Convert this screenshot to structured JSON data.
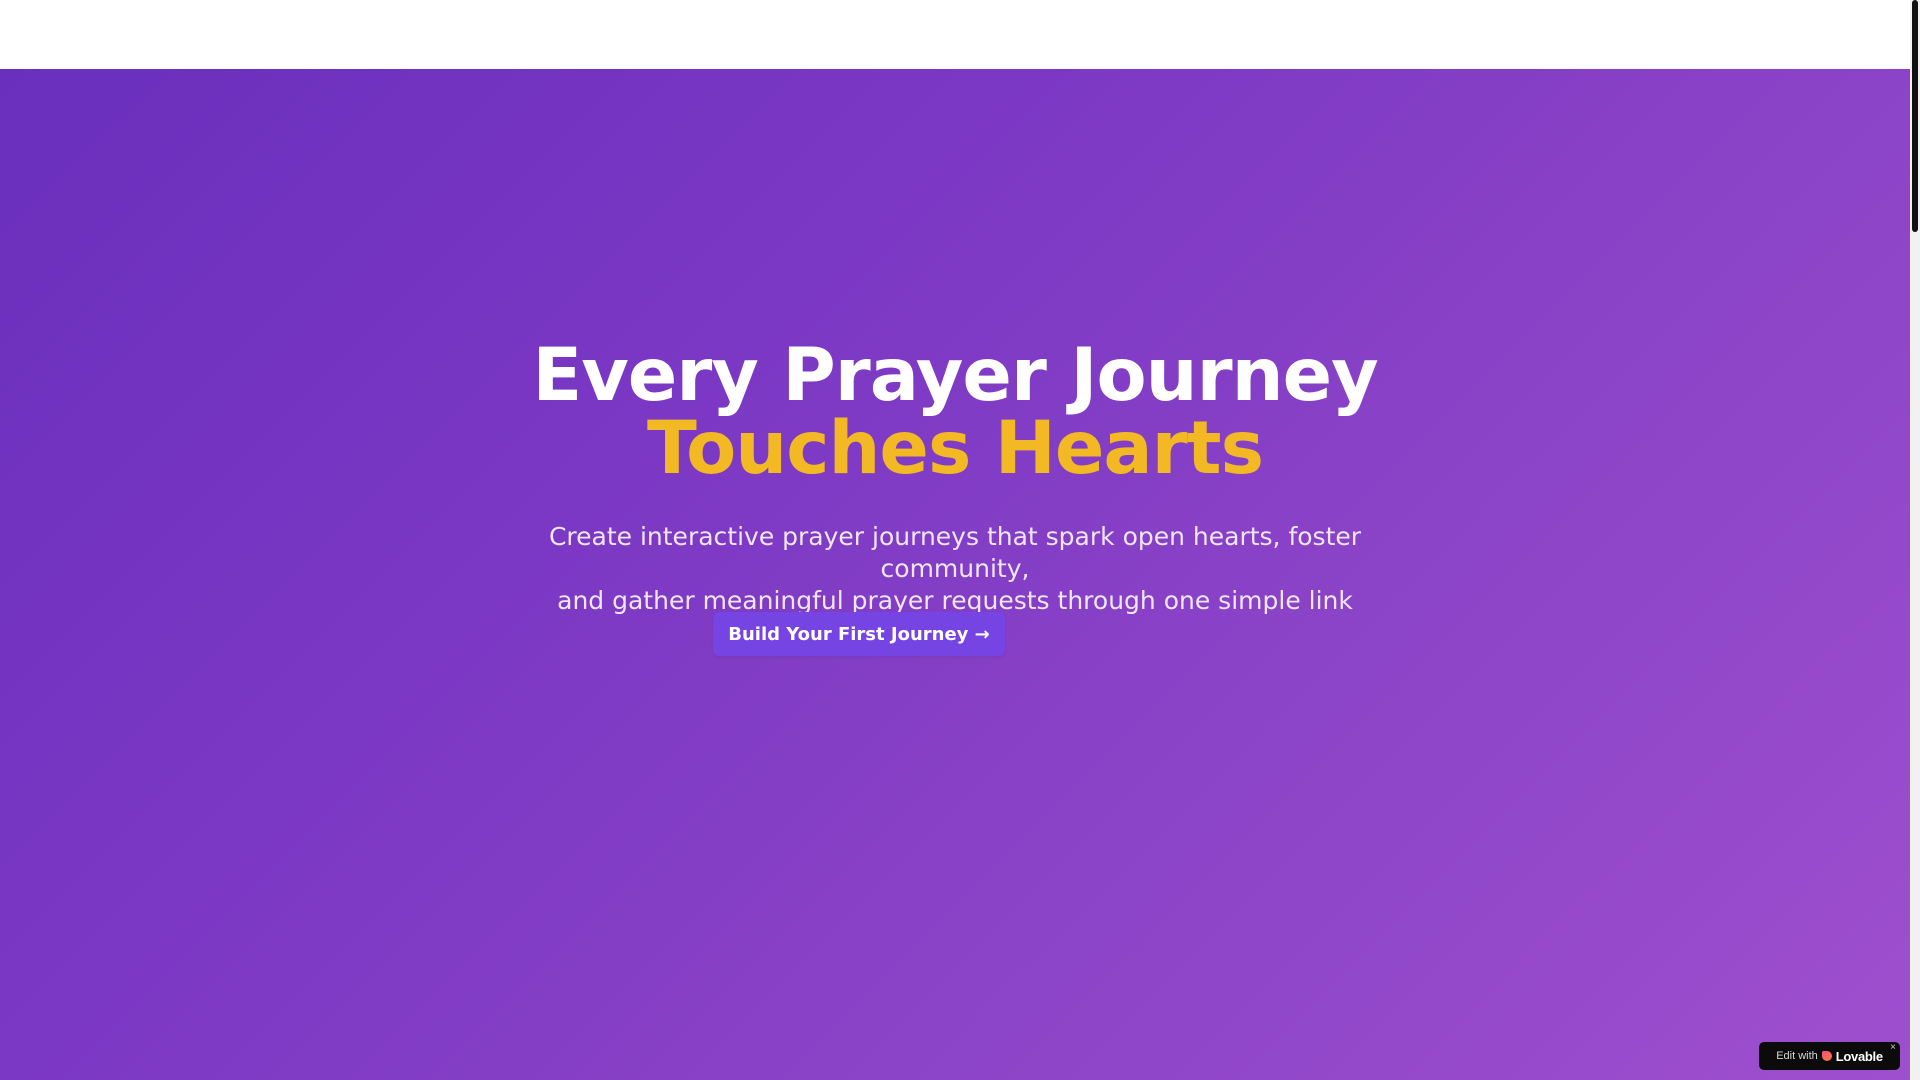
{
  "hero": {
    "headline_white": "Every Prayer Journey",
    "headline_accent": "Touches Hearts",
    "subtitle_line1": "Create interactive prayer journeys that spark open hearts, foster community,",
    "subtitle_line2": "and gather meaningful prayer requests through one simple link",
    "cta_label": "Build Your First Journey →"
  },
  "badge": {
    "edit_text": "Edit with",
    "brand": "Lovable",
    "close_icon": "×"
  },
  "colors": {
    "accent_yellow": "#f2b925",
    "gradient_start": "#6a2fbd",
    "gradient_end": "#9e4fce",
    "button_bg": "#7744e4"
  },
  "icons": [
    "lovable-logo-icon",
    "close-icon",
    "arrow-right-icon"
  ]
}
